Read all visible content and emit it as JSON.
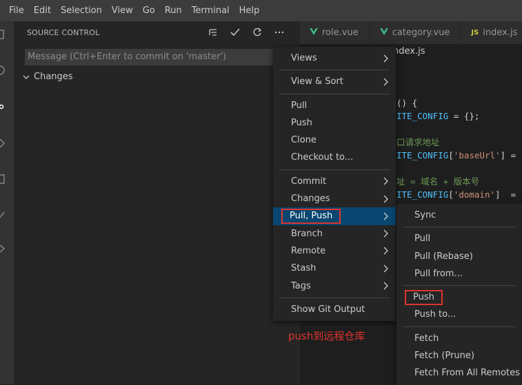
{
  "menubar": [
    "File",
    "Edit",
    "Selection",
    "View",
    "Go",
    "Run",
    "Terminal",
    "Help"
  ],
  "sidebar": {
    "title": "SOURCE CONTROL",
    "message_placeholder": "Message (Ctrl+Enter to commit on 'master')",
    "changes_label": "Changes"
  },
  "tabs": [
    "role.vue",
    "category.vue",
    "index.js"
  ],
  "breadcrumb": "ndex.js",
  "code_lines": [
    {
      "text": "() {",
      "parts": [
        {
          "t": "() {",
          "c": "#d4d4d4"
        }
      ]
    },
    {
      "text": "ITE_CONFIG = {};",
      "parts": [
        {
          "t": "ITE_CONFIG",
          "c": "#4fc1ff"
        },
        {
          "t": " = {};",
          "c": "#d4d4d4"
        }
      ]
    },
    {
      "text": "",
      "parts": []
    },
    {
      "text": "口请求地址",
      "parts": [
        {
          "t": "口请求地址",
          "c": "#6a9955"
        }
      ]
    },
    {
      "text": "ITE_CONFIG['baseUrl'] =",
      "parts": [
        {
          "t": "ITE_CONFIG",
          "c": "#4fc1ff"
        },
        {
          "t": "[",
          "c": "#d4d4d4"
        },
        {
          "t": "'baseUrl'",
          "c": "#ce9178"
        },
        {
          "t": "] =",
          "c": "#d4d4d4"
        }
      ]
    },
    {
      "text": "",
      "parts": []
    },
    {
      "text": "址 = 域名 + 版本号",
      "parts": [
        {
          "t": "址 = 域名 + 版本号",
          "c": "#6a9955"
        }
      ]
    },
    {
      "text": "ITE_CONFIG['domain']  =",
      "parts": [
        {
          "t": "ITE_CONFIG",
          "c": "#4fc1ff"
        },
        {
          "t": "[",
          "c": "#d4d4d4"
        },
        {
          "t": "'domain'",
          "c": "#ce9178"
        },
        {
          "t": "]  =",
          "c": "#d4d4d4"
        }
      ]
    }
  ],
  "main_menu": {
    "groups": [
      [
        {
          "label": "Views",
          "submenu": true
        }
      ],
      [
        {
          "label": "View & Sort",
          "submenu": true
        }
      ],
      [
        {
          "label": "Pull"
        },
        {
          "label": "Push"
        },
        {
          "label": "Clone"
        },
        {
          "label": "Checkout to..."
        }
      ],
      [
        {
          "label": "Commit",
          "submenu": true
        },
        {
          "label": "Changes",
          "submenu": true
        },
        {
          "label": "Pull, Push",
          "submenu": true,
          "active": true,
          "highlight": true
        },
        {
          "label": "Branch",
          "submenu": true
        },
        {
          "label": "Remote",
          "submenu": true
        },
        {
          "label": "Stash",
          "submenu": true
        },
        {
          "label": "Tags",
          "submenu": true
        }
      ],
      [
        {
          "label": "Show Git Output"
        }
      ]
    ]
  },
  "sub_menu": {
    "groups": [
      [
        {
          "label": "Sync"
        }
      ],
      [
        {
          "label": "Pull"
        },
        {
          "label": "Pull (Rebase)"
        },
        {
          "label": "Pull from..."
        }
      ],
      [
        {
          "label": "Push",
          "highlight": true
        },
        {
          "label": "Push to..."
        }
      ],
      [
        {
          "label": "Fetch"
        },
        {
          "label": "Fetch (Prune)"
        },
        {
          "label": "Fetch From All Remotes"
        }
      ]
    ]
  },
  "annotation": "push到远程仓库",
  "colors": {
    "accent": "#094771",
    "annotation": "#e0352f",
    "vue": "#41b883",
    "js": "#cbcb41"
  }
}
